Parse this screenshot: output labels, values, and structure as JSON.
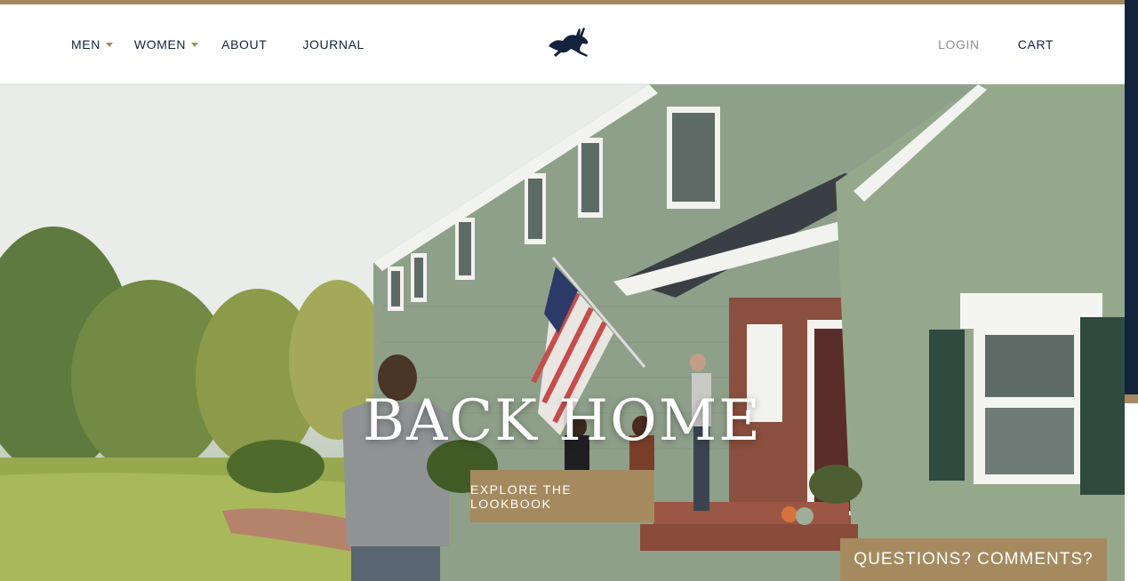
{
  "nav": {
    "men": "MEN",
    "women": "WOMEN",
    "about": "ABOUT",
    "journal": "JOURNAL",
    "login": "LOGIN",
    "cart": "CART"
  },
  "brand": {
    "logo_icon": "hare-icon"
  },
  "hero": {
    "title": "BACK HOME",
    "cta_label": "EXPLORE THE LOOKBOOK"
  },
  "feedback": {
    "label": "QUESTIONS? COMMENTS?"
  },
  "colors": {
    "accent": "#a58a60",
    "navy": "#13223d",
    "muted": "#8a8f99"
  }
}
